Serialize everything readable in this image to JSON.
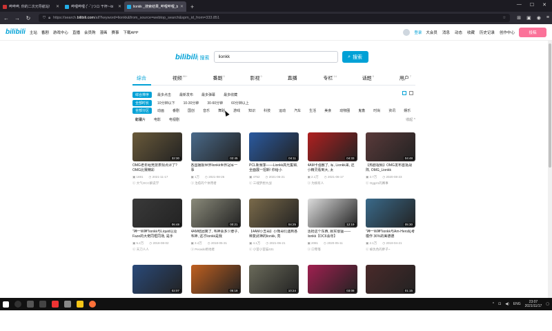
{
  "browser": {
    "tabs": [
      {
        "title": "哔哔哔, 你的二次元导航站!",
        "icon": "red"
      },
      {
        "title": "哔哩哔哩 (ﾟ-ﾟ)つロ 干杯~-bi",
        "icon": "bili"
      },
      {
        "title": "lionkk _搜索结果_哔哩哔哩_bi",
        "icon": "bili",
        "active": true
      }
    ],
    "url_prefix": "https://search.",
    "url_host": "bilibili.com",
    "url_rest": "/all?keyword=lionkk&from_source=webtop_search&spm_id_from=333.851"
  },
  "header": {
    "logo": "bilibili",
    "nav": [
      "主站",
      "番剧",
      "游戏中心",
      "直播",
      "会员购",
      "漫画",
      "赛事",
      "下载APP"
    ],
    "login": "登录",
    "right": [
      "大会员",
      "消息",
      "动态",
      "收藏",
      "历史记录",
      "创作中心"
    ],
    "publish": "投稿"
  },
  "search": {
    "logo": "bilibili",
    "logo_sub": "| 搜索",
    "query": "lionkk",
    "button": "搜索"
  },
  "type_tabs": [
    {
      "label": "综合",
      "count": "",
      "active": true
    },
    {
      "label": "视频",
      "count": "99+"
    },
    {
      "label": "番剧",
      "count": "0"
    },
    {
      "label": "影视",
      "count": "0"
    },
    {
      "label": "直播",
      "count": ""
    },
    {
      "label": "专栏",
      "count": "14"
    },
    {
      "label": "话题",
      "count": "0"
    },
    {
      "label": "用户",
      "count": "7"
    }
  ],
  "filters": {
    "sort": [
      "综合排序",
      "最多点击",
      "最新发布",
      "最多弹幕",
      "最多收藏"
    ],
    "duration": [
      "全部时长",
      "10分钟以下",
      "10-30分钟",
      "30-60分钟",
      "60分钟以上"
    ],
    "zones": [
      "全部分区",
      "动画",
      "番剧",
      "国创",
      "音乐",
      "舞蹈",
      "游戏",
      "知识",
      "科技",
      "运动",
      "汽车",
      "生活",
      "美食",
      "动物圈",
      "鬼畜",
      "时尚",
      "资讯",
      "娱乐",
      "影视"
    ],
    "zones2": [
      "纪录片",
      "电影",
      "电视剧"
    ],
    "fold": "收起 ^"
  },
  "videos": [
    {
      "title": "OMG老年组竞技表现点评了? OMG比赛精彩",
      "duration": "32:30",
      "views": "1691",
      "date": "2021-11-17",
      "up": "大气OCC解说学",
      "color": "#6a5a3a"
    },
    {
      "title": "各国播报世界lionkk世界冠军一事",
      "duration": "02:45",
      "views": "1万",
      "date": "2021-08-26",
      "up": "治愈的个体用者",
      "color": "#4a6a8a"
    },
    {
      "title": "PCL新赛季——Lionkk高光集锦, 全面展一招新! 你给小",
      "duration": "04:11",
      "views": "4752",
      "date": "2021-06-21",
      "up": "三魂梦想大战",
      "color": "#2a5aa0"
    },
    {
      "title": "4AM卡强散了, 军, Lionkk来, 还小精灵看到大, 太",
      "duration": "04:33",
      "views": "2.1万",
      "date": "2021-06-17",
      "up": "为搞有人",
      "color": "#b02020"
    },
    {
      "title": "【热剧视频】OMG发布首批战阵, OMG_Lionkk",
      "duration": "04:48",
      "views": "3.7万",
      "date": "2020-08-23",
      "up": "Ogg21的赛事",
      "color": "#5a3a3a"
    },
    {
      "title": "\"神一W神\"lionkk与Liquid以及Faze的大佬同框同场, 是手",
      "duration": "06:48",
      "views": "5.2万",
      "date": "2018-08-02",
      "up": "天刀人人",
      "color": "#3a3a3a"
    },
    {
      "title": "4AM结团离了, 韦神会多少脖子, 韦神, 这才lionkk是我",
      "duration": "00:21",
      "views": "3.4万",
      "date": "2018-05-31",
      "up": "Pecado绝地者",
      "color": "#8a8a7a"
    },
    {
      "title": "【4AM小丑哥】小熊哥们遇到各种复武神的lionkk, 亮",
      "duration": "04:25",
      "views": "4.1万",
      "date": "2021-06-21",
      "up": "小苗小苗猫431",
      "color": "#7a6a4a"
    },
    {
      "title": "活抢这个东西, 就实很猛——lionkk【OC6会年】",
      "duration": "12:19",
      "views": "2081",
      "date": "2020-05-11",
      "up": "口零落",
      "color": "#dcdcdc"
    },
    {
      "title": "\"神一W神\"lionkk与Am-Hero乱考模作 36%的美德德",
      "duration": "05:30",
      "views": "2.1万",
      "date": "2019-04-21",
      "up": "被仇色的胖子~",
      "color": "#3a6a8a"
    },
    {
      "title": "",
      "duration": "02:07",
      "views": "",
      "date": "",
      "up": "",
      "color": "#2a4a7a"
    },
    {
      "title": "",
      "duration": "05:18",
      "views": "",
      "date": "",
      "up": "",
      "color": "#c06020"
    },
    {
      "title": "",
      "duration": "10:24",
      "views": "",
      "date": "",
      "up": "",
      "color": "#6a6a5a"
    },
    {
      "title": "",
      "duration": "03:08",
      "views": "",
      "date": "",
      "up": "",
      "color": "#a02050"
    },
    {
      "title": "",
      "duration": "01:15",
      "views": "",
      "date": "",
      "up": "",
      "color": "#4a2a2a"
    }
  ],
  "taskbar": {
    "lang": "ENG",
    "time": "23:07",
    "date": "2021/11/17"
  }
}
